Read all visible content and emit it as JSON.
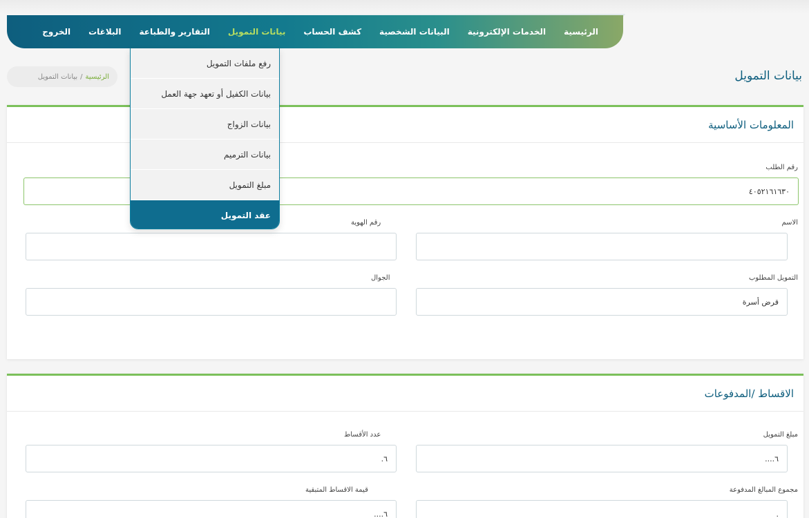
{
  "nav": {
    "items": [
      {
        "label": "الرئيسية",
        "active": false
      },
      {
        "label": "الخدمات الإلكترونية",
        "active": false
      },
      {
        "label": "البيانات الشخصية",
        "active": false
      },
      {
        "label": "كشف الحساب",
        "active": false
      },
      {
        "label": "بيانات التمويل",
        "active": true
      },
      {
        "label": "التقارير والطباعة",
        "active": false
      },
      {
        "label": "البلاغات",
        "active": false
      },
      {
        "label": "الخروج",
        "active": false
      }
    ]
  },
  "dropdown": {
    "items": [
      "رفع ملفات التمويل",
      "بيانات الكفيل أو تعهد جهة العمل",
      "بيانات الزواج",
      "بيانات الترميم",
      "مبلغ التمويل",
      "عقد التمويل"
    ]
  },
  "page": {
    "title": "بيانات التمويل"
  },
  "breadcrumb": {
    "home": "الرئيسية",
    "separator": "/",
    "current": "بيانات التمويل"
  },
  "basic": {
    "title": "المعلومات الأساسية",
    "request_number_label": "رقم الطلب",
    "request_number_value": "٤٠٥٢١٦١٦٣٠",
    "name_label": "الاسم",
    "name_value": "",
    "id_label": "رقم الهوية",
    "id_value": "",
    "financing_label": "التمويل المطلوب",
    "financing_value": "قرض أسرة",
    "mobile_label": "الجوال",
    "mobile_value": ""
  },
  "installments": {
    "title": "الاقساط /المدفوعات",
    "amount_label": "مبلغ التمويل",
    "amount_value": "٦....",
    "count_label": "عدد الأقساط",
    "count_value": "٦.",
    "paid_label": "مجموع المبالغ المدفوعة",
    "paid_value": ".",
    "remaining_label": "قيمة الاقساط المتبقية",
    "remaining_value": "٦...."
  },
  "colors": {
    "primary": "#0e5e7e",
    "accent": "#7bc05a",
    "active_nav": "#b5dc61"
  }
}
